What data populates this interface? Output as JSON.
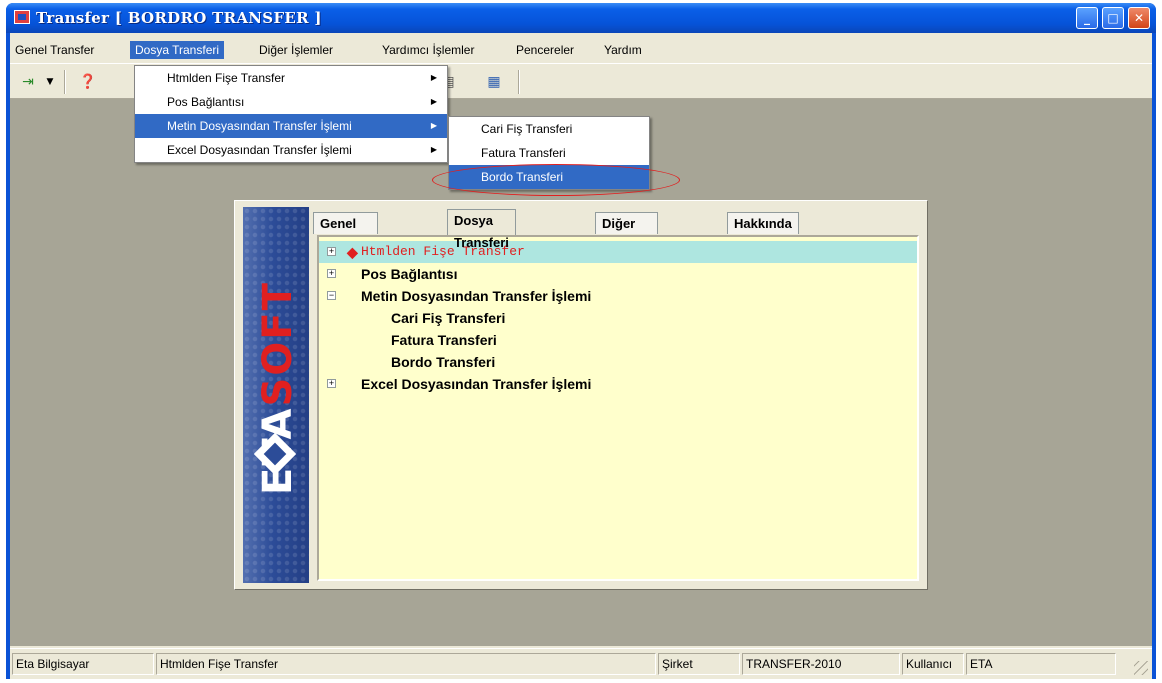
{
  "window": {
    "title": "Transfer [ BORDRO TRANSFER ]"
  },
  "menubar": {
    "items": [
      "Genel Transfer",
      "Dosya Transferi",
      "Diğer İşlemler",
      "Yardımcı İşlemler",
      "Pencereler",
      "Yardım"
    ],
    "active": "Dosya Transferi"
  },
  "dropdown": {
    "items": [
      "Htmlden Fişe Transfer",
      "Pos Bağlantısı",
      "Metin Dosyasından Transfer İşlemi",
      "Excel Dosyasından Transfer İşlemi"
    ],
    "highlighted": "Metin Dosyasından Transfer İşlemi"
  },
  "submenu": {
    "items": [
      "Cari Fiş Transferi",
      "Fatura Transferi",
      "Bordo Transferi"
    ],
    "highlighted": "Bordo Transferi"
  },
  "panel": {
    "tabs": [
      "Genel Transfer",
      "Dosya Transferi",
      "Diğer İşlemler",
      "Hakkında"
    ],
    "active_tab": "Dosya Transferi",
    "logo_text": "ETASOFT",
    "tree": [
      {
        "label": "Htmlden Fişe Transfer",
        "level": 0,
        "expander": "+",
        "selected": true
      },
      {
        "label": "Pos Bağlantısı",
        "level": 0,
        "expander": "+"
      },
      {
        "label": "Metin Dosyasından Transfer İşlemi",
        "level": 0,
        "expander": "−"
      },
      {
        "label": "Cari Fiş Transferi",
        "level": 1
      },
      {
        "label": "Fatura Transferi",
        "level": 1
      },
      {
        "label": "Bordo Transferi",
        "level": 1
      },
      {
        "label": "Excel Dosyasından Transfer İşlemi",
        "level": 0,
        "expander": "+"
      }
    ]
  },
  "statusbar": {
    "company_name": "Eta Bilgisayar",
    "current_item": "Htmlden Fişe Transfer",
    "company_label": "Şirket",
    "company_value": "TRANSFER-2010",
    "user_label": "Kullanıcı",
    "user_value": "ETA"
  },
  "colors": {
    "titlebar": "#0653d8",
    "highlight": "#316ac5",
    "tree_bg": "#ffffcc",
    "mdi_bg": "#a7a596",
    "accent_red": "#e02020"
  }
}
